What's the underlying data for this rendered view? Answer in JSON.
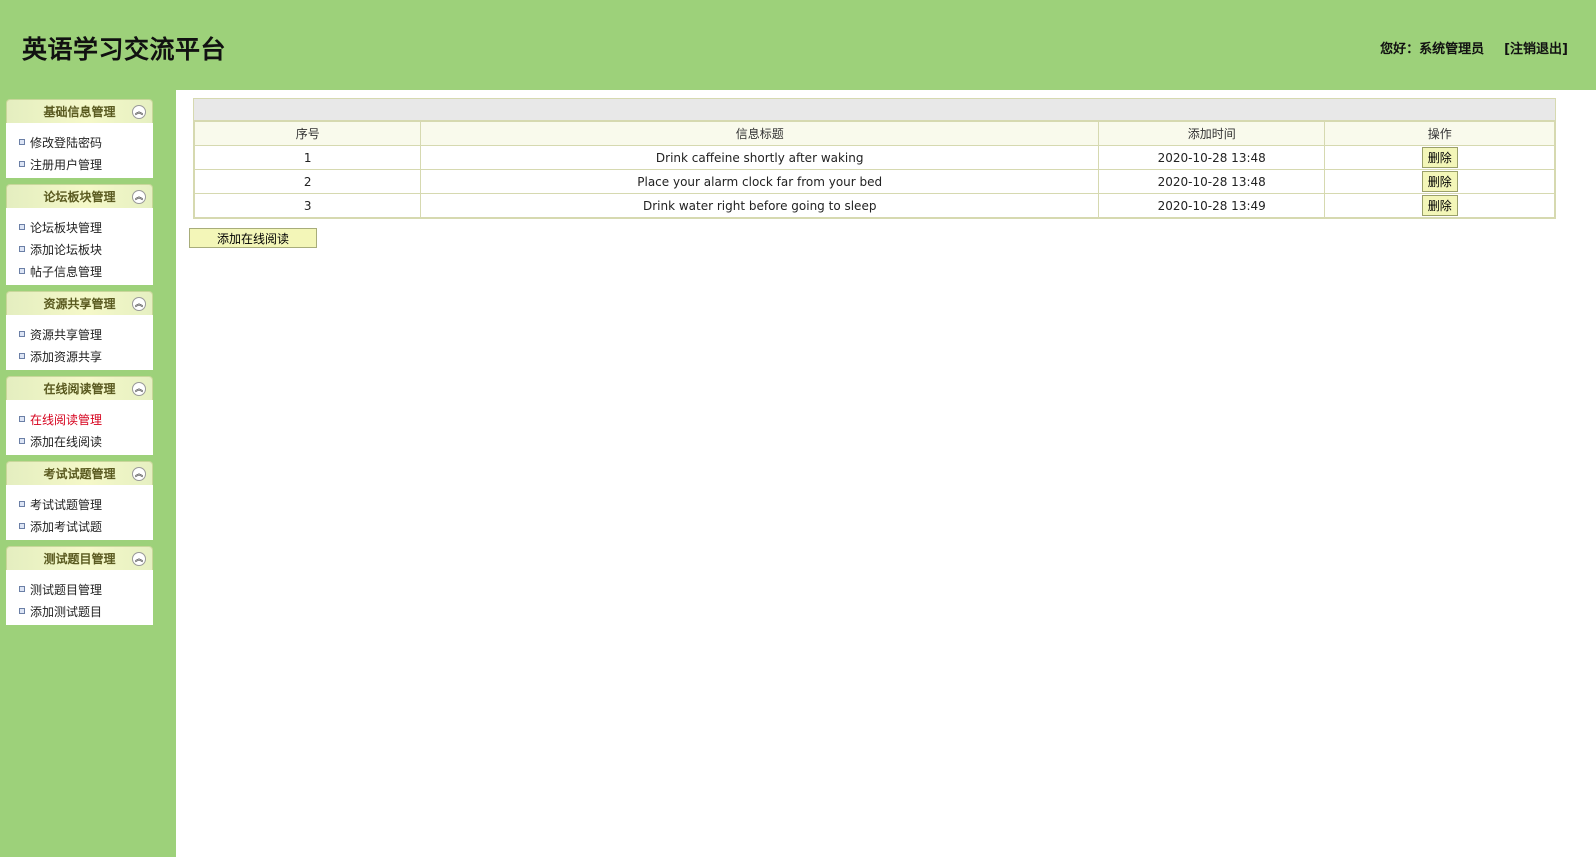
{
  "header": {
    "title": "英语学习交流平台",
    "greeting": "您好：系统管理员",
    "logout_label": "[注销退出]"
  },
  "sidebar": {
    "groups": [
      {
        "title": "基础信息管理",
        "items": [
          "修改登陆密码",
          "注册用户管理"
        ]
      },
      {
        "title": "论坛板块管理",
        "items": [
          "论坛板块管理",
          "添加论坛板块",
          "帖子信息管理"
        ]
      },
      {
        "title": "资源共享管理",
        "items": [
          "资源共享管理",
          "添加资源共享"
        ]
      },
      {
        "title": "在线阅读管理",
        "items": [
          "在线阅读管理",
          "添加在线阅读"
        ]
      },
      {
        "title": "考试试题管理",
        "items": [
          "考试试题管理",
          "添加考试试题"
        ]
      },
      {
        "title": "测试题目管理",
        "items": [
          "测试题目管理",
          "添加测试题目"
        ]
      }
    ],
    "active_item": "在线阅读管理",
    "collapse_glyph": "︽"
  },
  "table": {
    "columns": [
      "序号",
      "信息标题",
      "添加时间",
      "操作"
    ],
    "rows": [
      {
        "index": "1",
        "title": "Drink caffeine shortly after waking",
        "time": "2020-10-28 13:48",
        "action": "删除"
      },
      {
        "index": "2",
        "title": "Place your alarm clock far from your bed",
        "time": "2020-10-28 13:48",
        "action": "删除"
      },
      {
        "index": "3",
        "title": "Drink water right before going to sleep",
        "time": "2020-10-28 13:49",
        "action": "删除"
      }
    ]
  },
  "add_button_label": "添加在线阅读",
  "colors": {
    "background": "#9dd17a",
    "active_menu": "#d6001c",
    "button": "#f3f6b8"
  }
}
